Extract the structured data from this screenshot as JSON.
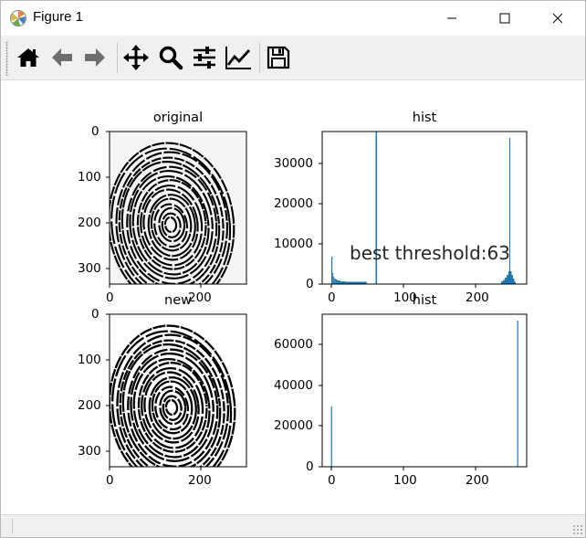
{
  "window": {
    "title": "Figure 1"
  },
  "toolbar": {
    "buttons": [
      {
        "name": "home",
        "icon": "home-icon"
      },
      {
        "name": "back",
        "icon": "arrow-left-icon"
      },
      {
        "name": "forward",
        "icon": "arrow-right-icon"
      },
      {
        "name": "pan",
        "icon": "move-icon"
      },
      {
        "name": "zoom",
        "icon": "magnifier-icon"
      },
      {
        "name": "subplots",
        "icon": "sliders-icon"
      },
      {
        "name": "edit-axes",
        "icon": "line-chart-icon"
      },
      {
        "name": "save",
        "icon": "floppy-disk-icon"
      }
    ]
  },
  "figure": {
    "annotation": "best threshold:63",
    "subplots": {
      "original": {
        "title": "original",
        "xticks": [
          "0",
          "200"
        ],
        "yticks": [
          "0",
          "100",
          "200",
          "300"
        ]
      },
      "hist1": {
        "title": "hist",
        "xticks": [
          "0",
          "100",
          "200"
        ],
        "yticks": [
          "0",
          "10000",
          "20000",
          "30000"
        ]
      },
      "new": {
        "title": "new",
        "xticks": [
          "0",
          "200"
        ],
        "yticks": [
          "0",
          "100",
          "200",
          "300"
        ]
      },
      "hist2": {
        "title": "hist",
        "xticks": [
          "0",
          "100",
          "200"
        ],
        "yticks": [
          "0",
          "20000",
          "40000",
          "60000"
        ]
      }
    }
  },
  "colors": {
    "bar": "#1f77b4",
    "toolbar_bg": "#f0f0f0",
    "axes_bg": "#f5f5f5"
  }
}
